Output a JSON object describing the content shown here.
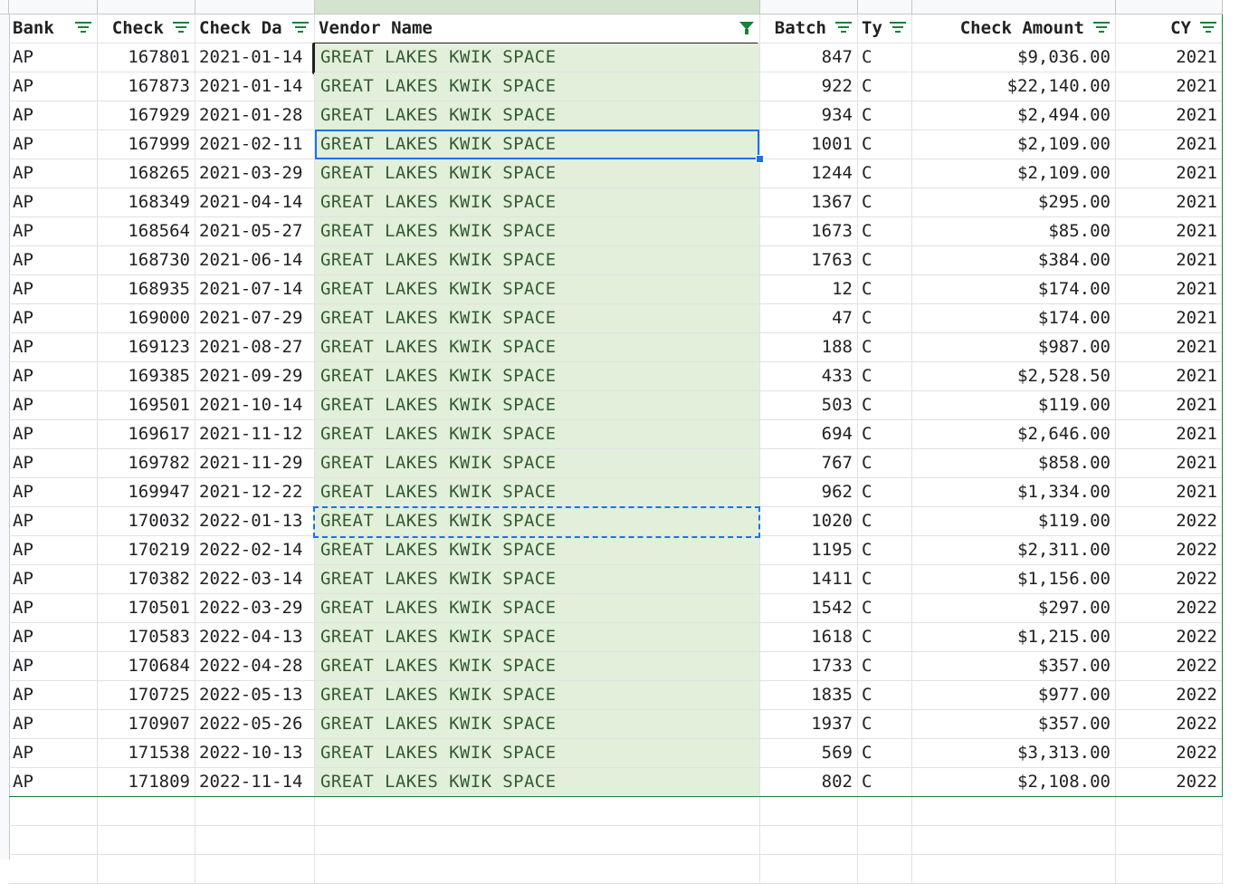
{
  "sheet": {
    "headers": [
      "Bank",
      "Check",
      "Check Da",
      "Vendor Name",
      "Batch",
      "Ty",
      "Check Amount",
      "CY"
    ],
    "filtered_column": "Vendor Name",
    "rows": [
      [
        "AP",
        "167801",
        "2021-01-14",
        "GREAT LAKES KWIK SPACE",
        "847",
        "C",
        "$9,036.00",
        "2021"
      ],
      [
        "AP",
        "167873",
        "2021-01-14",
        "GREAT LAKES KWIK SPACE",
        "922",
        "C",
        "$22,140.00",
        "2021"
      ],
      [
        "AP",
        "167929",
        "2021-01-28",
        "GREAT LAKES KWIK SPACE",
        "934",
        "C",
        "$2,494.00",
        "2021"
      ],
      [
        "AP",
        "167999",
        "2021-02-11",
        "GREAT LAKES KWIK SPACE",
        "1001",
        "C",
        "$2,109.00",
        "2021"
      ],
      [
        "AP",
        "168265",
        "2021-03-29",
        "GREAT LAKES KWIK SPACE",
        "1244",
        "C",
        "$2,109.00",
        "2021"
      ],
      [
        "AP",
        "168349",
        "2021-04-14",
        "GREAT LAKES KWIK SPACE",
        "1367",
        "C",
        "$295.00",
        "2021"
      ],
      [
        "AP",
        "168564",
        "2021-05-27",
        "GREAT LAKES KWIK SPACE",
        "1673",
        "C",
        "$85.00",
        "2021"
      ],
      [
        "AP",
        "168730",
        "2021-06-14",
        "GREAT LAKES KWIK SPACE",
        "1763",
        "C",
        "$384.00",
        "2021"
      ],
      [
        "AP",
        "168935",
        "2021-07-14",
        "GREAT LAKES KWIK SPACE",
        "12",
        "C",
        "$174.00",
        "2021"
      ],
      [
        "AP",
        "169000",
        "2021-07-29",
        "GREAT LAKES KWIK SPACE",
        "47",
        "C",
        "$174.00",
        "2021"
      ],
      [
        "AP",
        "169123",
        "2021-08-27",
        "GREAT LAKES KWIK SPACE",
        "188",
        "C",
        "$987.00",
        "2021"
      ],
      [
        "AP",
        "169385",
        "2021-09-29",
        "GREAT LAKES KWIK SPACE",
        "433",
        "C",
        "$2,528.50",
        "2021"
      ],
      [
        "AP",
        "169501",
        "2021-10-14",
        "GREAT LAKES KWIK SPACE",
        "503",
        "C",
        "$119.00",
        "2021"
      ],
      [
        "AP",
        "169617",
        "2021-11-12",
        "GREAT LAKES KWIK SPACE",
        "694",
        "C",
        "$2,646.00",
        "2021"
      ],
      [
        "AP",
        "169782",
        "2021-11-29",
        "GREAT LAKES KWIK SPACE",
        "767",
        "C",
        "$858.00",
        "2021"
      ],
      [
        "AP",
        "169947",
        "2021-12-22",
        "GREAT LAKES KWIK SPACE",
        "962",
        "C",
        "$1,334.00",
        "2021"
      ],
      [
        "AP",
        "170032",
        "2022-01-13",
        "GREAT LAKES KWIK SPACE",
        "1020",
        "C",
        "$119.00",
        "2022"
      ],
      [
        "AP",
        "170219",
        "2022-02-14",
        "GREAT LAKES KWIK SPACE",
        "1195",
        "C",
        "$2,311.00",
        "2022"
      ],
      [
        "AP",
        "170382",
        "2022-03-14",
        "GREAT LAKES KWIK SPACE",
        "1411",
        "C",
        "$1,156.00",
        "2022"
      ],
      [
        "AP",
        "170501",
        "2022-03-29",
        "GREAT LAKES KWIK SPACE",
        "1542",
        "C",
        "$297.00",
        "2022"
      ],
      [
        "AP",
        "170583",
        "2022-04-13",
        "GREAT LAKES KWIK SPACE",
        "1618",
        "C",
        "$1,215.00",
        "2022"
      ],
      [
        "AP",
        "170684",
        "2022-04-28",
        "GREAT LAKES KWIK SPACE",
        "1733",
        "C",
        "$357.00",
        "2022"
      ],
      [
        "AP",
        "170725",
        "2022-05-13",
        "GREAT LAKES KWIK SPACE",
        "1835",
        "C",
        "$977.00",
        "2022"
      ],
      [
        "AP",
        "170907",
        "2022-05-26",
        "GREAT LAKES KWIK SPACE",
        "1937",
        "C",
        "$357.00",
        "2022"
      ],
      [
        "AP",
        "171538",
        "2022-10-13",
        "GREAT LAKES KWIK SPACE",
        "569",
        "C",
        "$3,313.00",
        "2022"
      ],
      [
        "AP",
        "171809",
        "2022-11-14",
        "GREAT LAKES KWIK SPACE",
        "802",
        "C",
        "$2,108.00",
        "2022"
      ]
    ]
  },
  "icons": {
    "filter": "filter-lines-icon",
    "active_filter": "funnel-icon"
  },
  "colors": {
    "accent": "#188038",
    "selection": "#1a73e8",
    "highlight_fill": "#e2efda"
  }
}
